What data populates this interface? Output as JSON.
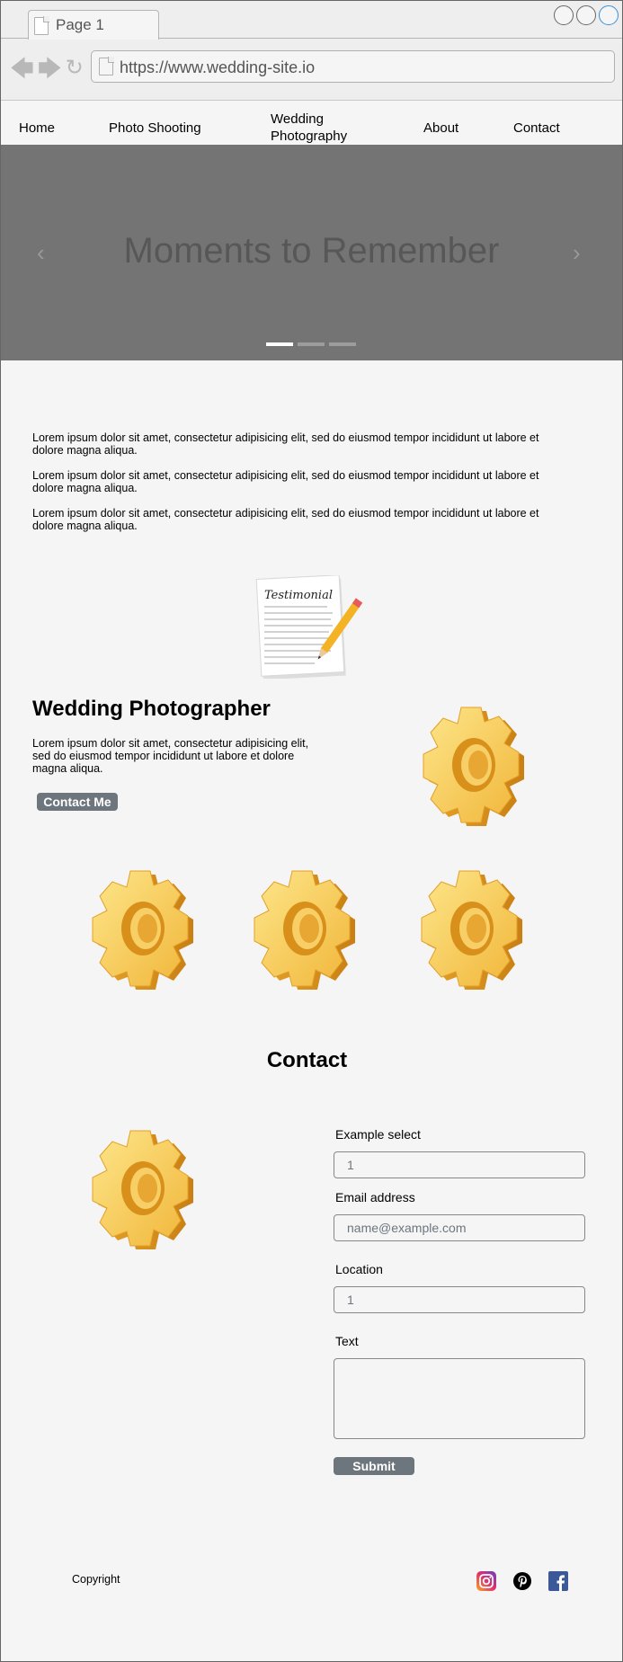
{
  "browser": {
    "tab_title": "Page 1",
    "url": "https://www.wedding-site.io"
  },
  "nav": {
    "items": [
      "Home",
      "Photo Shooting",
      "Wedding Photography",
      "About",
      "Contact"
    ]
  },
  "carousel": {
    "title": "Moments to Remember",
    "slide_count": 3,
    "active_index": 0
  },
  "intro": {
    "paragraphs": [
      "Lorem ipsum dolor sit amet, consectetur adipisicing elit, sed do eiusmod tempor incididunt ut labore et dolore magna aliqua.",
      "Lorem ipsum dolor sit amet, consectetur adipisicing elit, sed do eiusmod tempor incididunt ut labore et dolore magna aliqua.",
      "Lorem ipsum dolor sit amet, consectetur adipisicing elit, sed do eiusmod tempor incididunt ut labore et dolore magna aliqua."
    ]
  },
  "testimonial": {
    "heading": "Testimonial"
  },
  "feature": {
    "title": "Wedding Photographer",
    "text": "Lorem ipsum dolor sit amet, consectetur adipisicing elit, sed do eiusmod tempor incididunt ut labore et dolore magna aliqua.",
    "button": "Contact Me"
  },
  "contact": {
    "title": "Contact",
    "select_label": "Example select",
    "select_value": "1",
    "email_label": "Email address",
    "email_placeholder": "name@example.com",
    "location_label": "Location",
    "location_value": "1",
    "text_label": "Text",
    "submit": "Submit"
  },
  "footer": {
    "copyright": "Copyright",
    "social": [
      "instagram-icon",
      "pinterest-icon",
      "facebook-icon"
    ]
  },
  "colors": {
    "carousel_bg": "#747474",
    "button_bg": "#6d757d",
    "gear": "#f2b93b"
  }
}
